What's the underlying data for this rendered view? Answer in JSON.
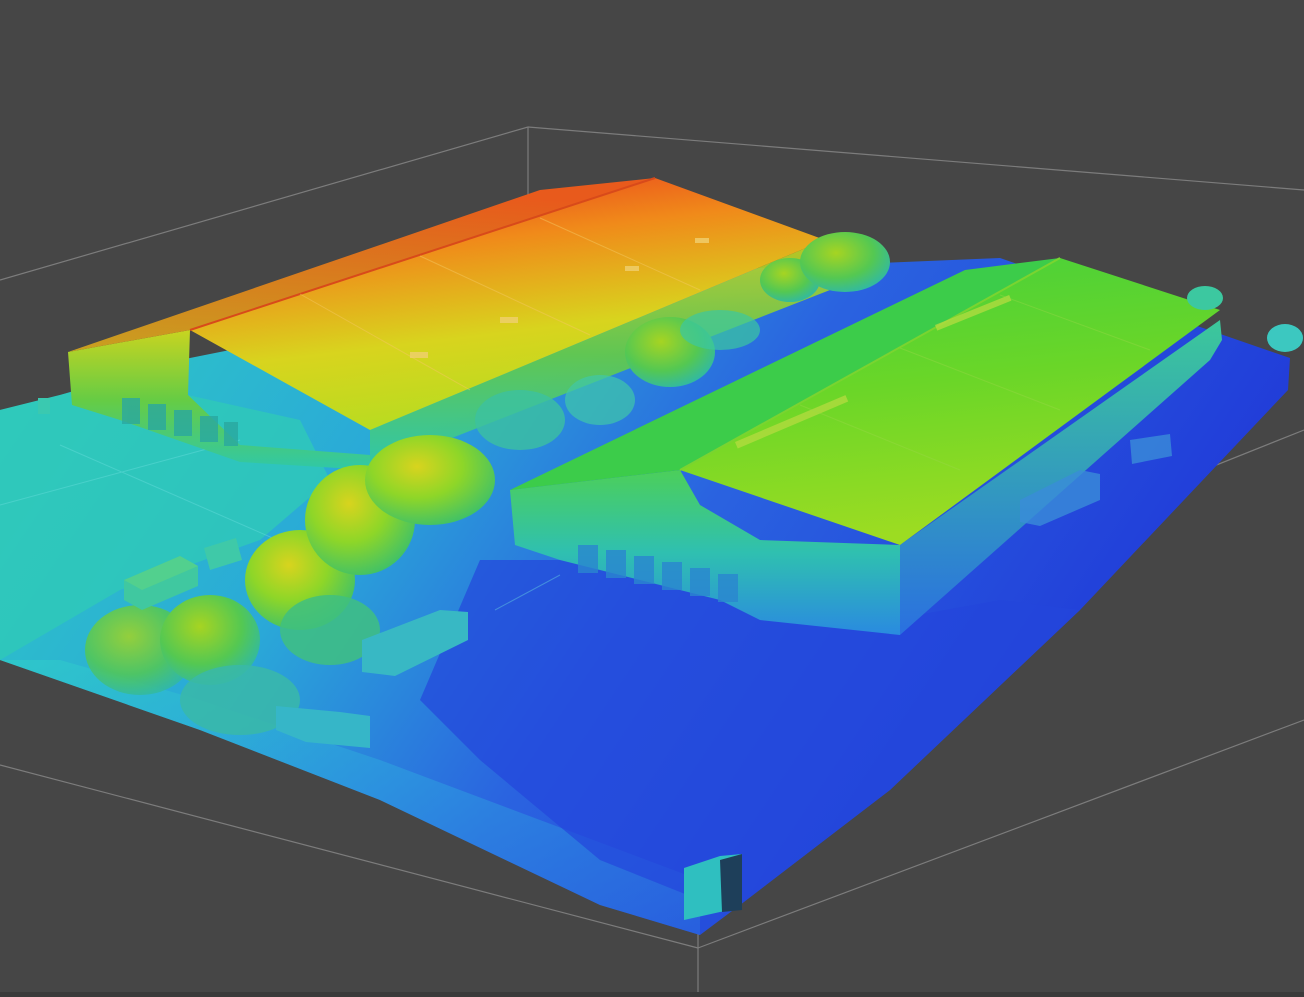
{
  "viewer": {
    "background_color": "#464646",
    "grid_line_color": "#7a7a7a",
    "colormap": [
      "#1e3fd8",
      "#2f7fe0",
      "#2fc8c8",
      "#33cc66",
      "#66dd22",
      "#c8dc1e",
      "#f0a018",
      "#e84020"
    ]
  },
  "scene": {
    "model_type": "elevation-colored 3D mesh",
    "objects": [
      "bounding-box",
      "ground-plane",
      "building-north",
      "building-south",
      "tree-row",
      "containers",
      "small-structure"
    ]
  }
}
